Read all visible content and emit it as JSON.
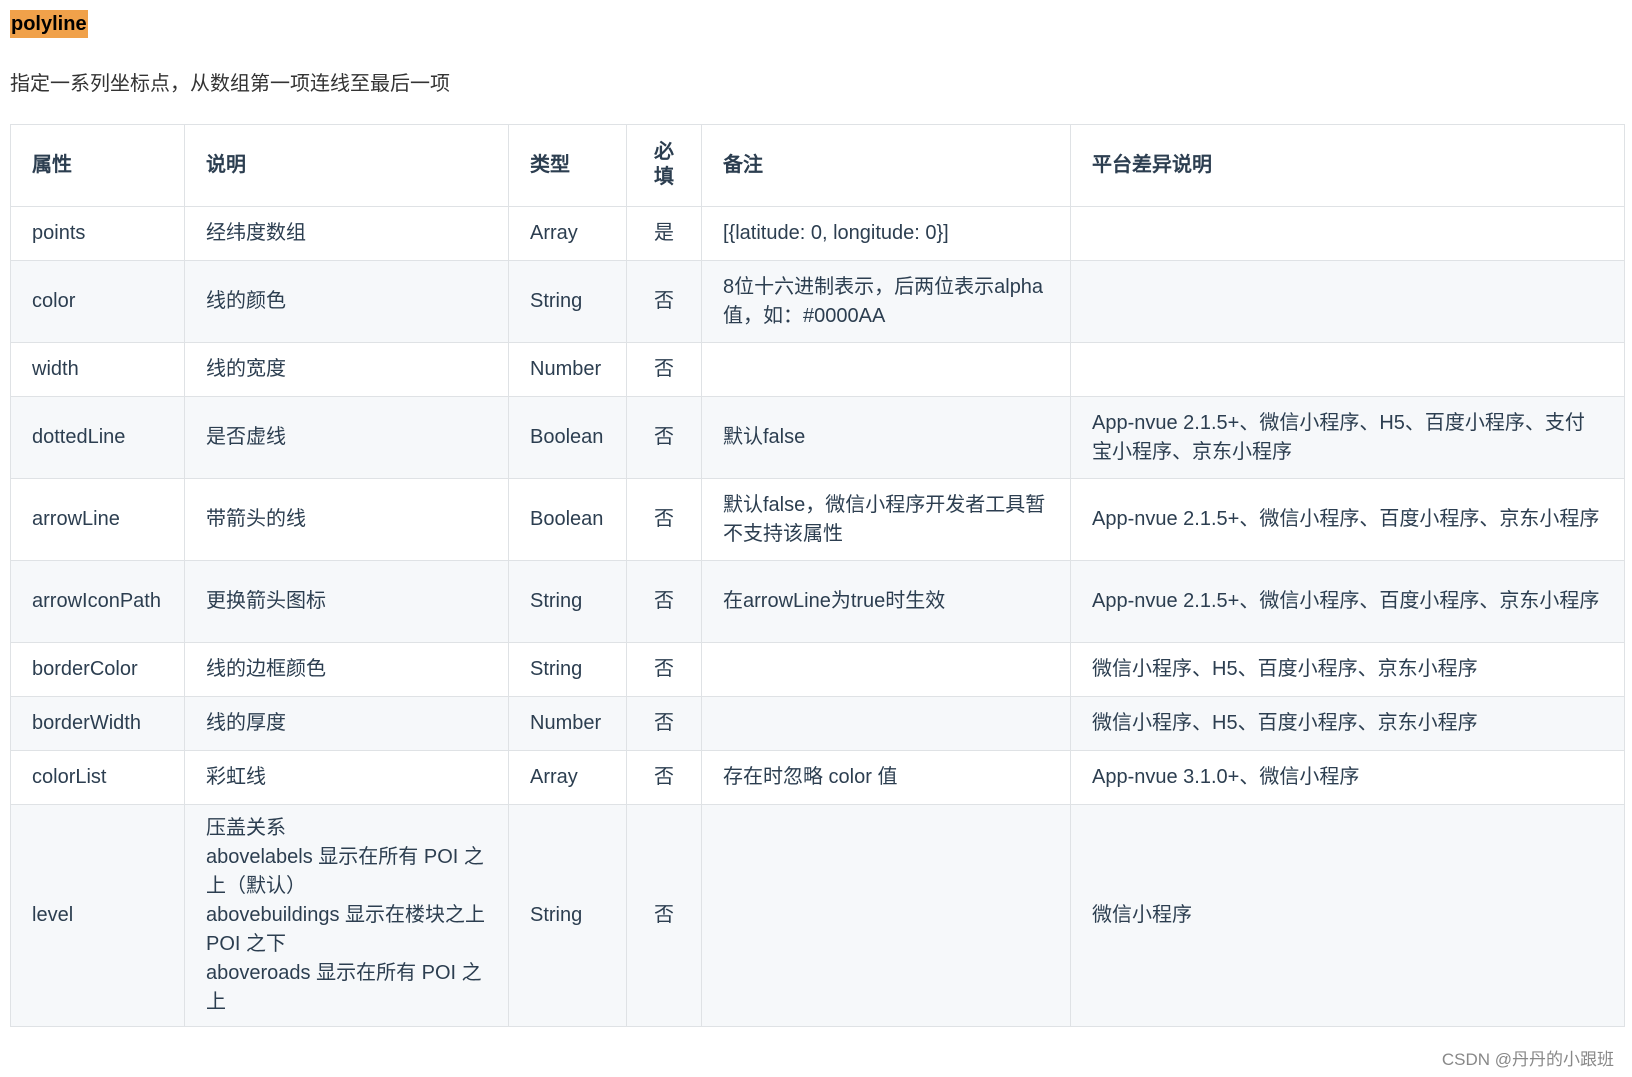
{
  "heading": "polyline",
  "intro": "指定一系列坐标点，从数组第一项连线至最后一项",
  "table": {
    "headers": [
      "属性",
      "说明",
      "类型",
      "必填",
      "备注",
      "平台差异说明"
    ],
    "rows": [
      [
        "points",
        "经纬度数组",
        "Array",
        "是",
        "[{latitude: 0, longitude: 0}]",
        ""
      ],
      [
        "color",
        "线的颜色",
        "String",
        "否",
        "8位十六进制表示，后两位表示alpha值，如：#0000AA",
        ""
      ],
      [
        "width",
        "线的宽度",
        "Number",
        "否",
        "",
        ""
      ],
      [
        "dottedLine",
        "是否虚线",
        "Boolean",
        "否",
        "默认false",
        "App-nvue 2.1.5+、微信小程序、H5、百度小程序、支付宝小程序、京东小程序"
      ],
      [
        "arrowLine",
        "带箭头的线",
        "Boolean",
        "否",
        "默认false，微信小程序开发者工具暂不支持该属性",
        "App-nvue 2.1.5+、微信小程序、百度小程序、京东小程序"
      ],
      [
        "arrowIconPath",
        "更换箭头图标",
        "String",
        "否",
        "在arrowLine为true时生效",
        "App-nvue 2.1.5+、微信小程序、百度小程序、京东小程序"
      ],
      [
        "borderColor",
        "线的边框颜色",
        "String",
        "否",
        "",
        "微信小程序、H5、百度小程序、京东小程序"
      ],
      [
        "borderWidth",
        "线的厚度",
        "Number",
        "否",
        "",
        "微信小程序、H5、百度小程序、京东小程序"
      ],
      [
        "colorList",
        "彩虹线",
        "Array",
        "否",
        "存在时忽略 color 值",
        "App-nvue 3.1.0+、微信小程序"
      ],
      [
        "level",
        "压盖关系\nabovelabels 显示在所有 POI 之上（默认）\nabovebuildings 显示在楼块之上 POI 之下\naboveroads 显示在所有 POI 之上",
        "String",
        "否",
        "",
        "微信小程序"
      ]
    ]
  },
  "watermark": "CSDN @丹丹的小跟班"
}
